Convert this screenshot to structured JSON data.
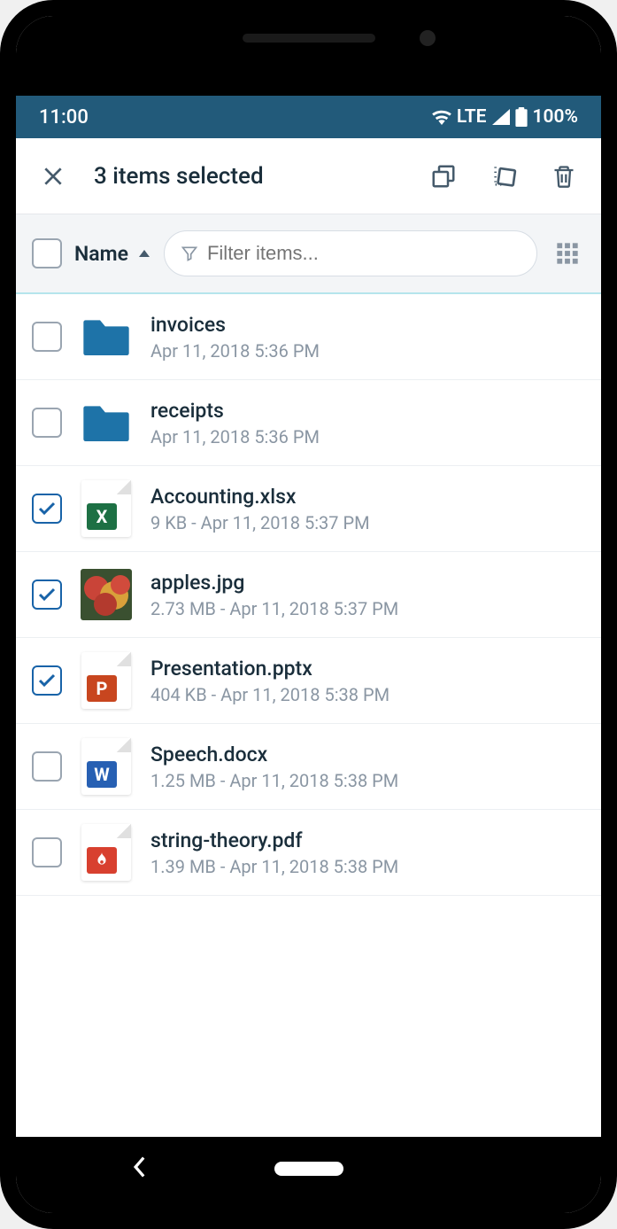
{
  "status": {
    "time": "11:00",
    "network": "LTE",
    "battery": "100%"
  },
  "appbar": {
    "title": "3 items selected"
  },
  "filter": {
    "sort_label": "Name",
    "placeholder": "Filter items..."
  },
  "files": [
    {
      "name": "invoices",
      "meta": "Apr 11, 2018 5:36 PM",
      "type": "folder",
      "checked": false
    },
    {
      "name": "receipts",
      "meta": "Apr 11, 2018 5:36 PM",
      "type": "folder",
      "checked": false
    },
    {
      "name": "Accounting.xlsx",
      "meta": "9 KB - Apr 11, 2018 5:37 PM",
      "type": "xlsx",
      "checked": true
    },
    {
      "name": "apples.jpg",
      "meta": "2.73 MB - Apr 11, 2018 5:37 PM",
      "type": "image",
      "checked": true
    },
    {
      "name": "Presentation.pptx",
      "meta": "404 KB - Apr 11, 2018 5:38 PM",
      "type": "pptx",
      "checked": true
    },
    {
      "name": "Speech.docx",
      "meta": "1.25 MB - Apr 11, 2018 5:38 PM",
      "type": "docx",
      "checked": false
    },
    {
      "name": "string-theory.pdf",
      "meta": "1.39 MB - Apr 11, 2018 5:38 PM",
      "type": "pdf",
      "checked": false
    }
  ],
  "icons": {
    "close": "close-icon",
    "copy": "copy-icon",
    "move": "move-icon",
    "delete": "trash-icon",
    "filter": "funnel-icon",
    "grid": "grid-view-icon",
    "sort_asc": "sort-asc-icon",
    "wifi": "wifi-icon",
    "signal": "signal-icon",
    "battery_full": "battery-full-icon"
  },
  "colors": {
    "status_bg": "#225a7a",
    "folder": "#1e73a8",
    "xlsx": "#1d7044",
    "pptx": "#c8461f",
    "docx": "#2760b3",
    "pdf": "#d8402f"
  }
}
